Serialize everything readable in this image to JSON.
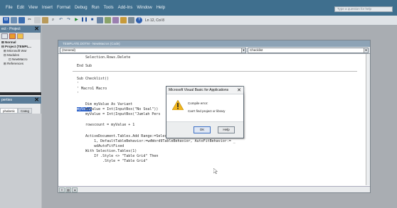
{
  "menubar": {
    "items": [
      "File",
      "Edit",
      "View",
      "Insert",
      "Format",
      "Debug",
      "Run",
      "Tools",
      "Add-Ins",
      "Window",
      "Help"
    ],
    "help_placeholder": "Type a question for help"
  },
  "toolbar": {
    "position": "Ln 12, Col 8",
    "icons": [
      "word-icon",
      "insert-icon",
      "save-icon",
      "cut-icon",
      "copy-icon",
      "paste-icon",
      "find-icon",
      "undo-icon",
      "redo-icon",
      "run-icon",
      "break-icon",
      "reset-icon",
      "design-icon",
      "project-explorer-icon",
      "properties-icon",
      "object-browser-icon",
      "toolbox-icon",
      "help-icon"
    ]
  },
  "project_panel": {
    "title": "ect - Project",
    "tree": [
      "Normal",
      "Project (TEMPL...",
      "Microsoft Wor",
      "Modules",
      "NewMacro",
      "References"
    ]
  },
  "properties_panel": {
    "title": "perties",
    "tabs": [
      "phabetic",
      "Categ"
    ]
  },
  "code_window": {
    "title": "TEMPLATE.DOTM - NewMacros (Code)",
    "object_combo": "(General)",
    "procedure_combo": "Checklist",
    "lines": [
      "    Selection.Rows.Delete",
      "",
      "End Sub",
      "",
      "",
      "Sub Checklist()",
      "'",
      "' Macro1 Macro",
      "'",
      "",
      "    Dim myValue As Variant",
      "    myValue = Int(InputBox(\"No Soal\"))",
      "    myValue = Int(InputBox(\"Jumlah Pers",
      "",
      "    rowscount = myValue + 1",
      "",
      "    ActiveDocument.Tables.Add Range:=Selection.Range, NumRows:=1, NumColumns:=",
      "        1, DefaultTableBehavior:=wdWord9TableBehavior, AutoFitBehavior:= _",
      "        wdAutoFitFixed",
      "    With Selection.Tables(1)",
      "        If .Style <> \"Table Grid\" Then",
      "            .Style = \"Table Grid\""
    ],
    "selected_text": "myValue"
  },
  "dialog": {
    "title": "Microsoft Visual Basic for Applications",
    "close": "✕",
    "message_line1": "Compile error:",
    "message_line2": "Can't find project or library",
    "ok_label": "OK",
    "help_label": "Help"
  },
  "colors": {
    "titlebar": "#3f6f8e",
    "selection": "#2f63c9",
    "warning": "#f2b51c"
  }
}
